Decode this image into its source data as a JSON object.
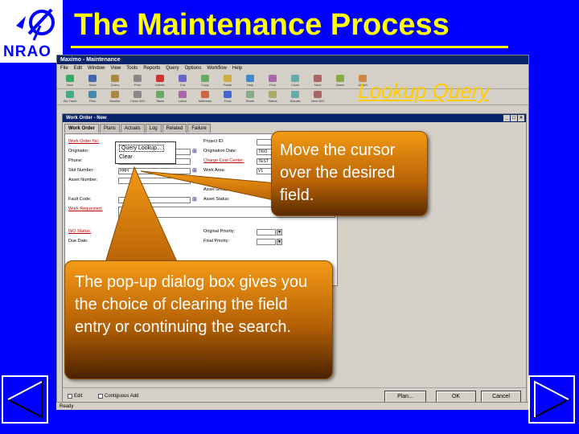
{
  "slide": {
    "title": "The Maintenance Process",
    "logo_text": "NRAO",
    "section_label": "Lookup Query"
  },
  "app": {
    "window_title": "Maximo - Maintenance",
    "menu": [
      "File",
      "Edit",
      "Window",
      "View",
      "Tools",
      "Reports",
      "Query",
      "Options",
      "Workflow",
      "Help"
    ],
    "toolbar_top": [
      "New",
      "Save",
      "Query",
      "Print",
      "Delete",
      "Cut",
      "Copy",
      "Paste",
      "Help",
      "Find",
      "Close",
      "Next",
      "Insert",
      "Attach"
    ],
    "toolbar_bottom": [
      "Wo Track",
      "Plan",
      "Monitor",
      "Close WO",
      "Tasks",
      "Labor",
      "Materials",
      "Tools",
      "Route",
      "Status",
      "Actuals",
      "Next WO"
    ],
    "inner_window_title": "Work Order - New",
    "tabs": [
      "Work Order",
      "Plans",
      "Actuals",
      "Log",
      "Related",
      "Failure"
    ],
    "fields_left": [
      {
        "label": "Work Order No:",
        "required": true
      },
      {
        "label": "Originator:",
        "required": false
      },
      {
        "label": "Phone:",
        "required": false
      },
      {
        "label": "Slot Number:",
        "required": false
      },
      {
        "label": "Asset Number:",
        "required": false
      },
      {
        "label": "Fault Code:",
        "required": false
      },
      {
        "label": "Work Requested:",
        "required": true
      },
      {
        "label": "WO Status:",
        "required": true
      },
      {
        "label": "Due Date:",
        "required": false
      }
    ],
    "fields_right": [
      {
        "label": "Project ID:",
        "required": false
      },
      {
        "label": "Origination Date:",
        "required": false
      },
      {
        "label": "Charge Cost Center:",
        "required": true
      },
      {
        "label": "Work Area:",
        "required": false
      },
      {
        "label": "Asset Group:",
        "required": false
      },
      {
        "label": "Asset Status:",
        "required": false
      },
      {
        "label": "Original Priority:",
        "required": false
      },
      {
        "label": "Final Priority:",
        "required": false
      }
    ],
    "field_values": {
      "slot": "HHH",
      "asset": "",
      "cost_center": "TEST",
      "origination": "7/6/0",
      "work_area": "V1",
      "priority": "",
      "final_priority": ""
    },
    "popup": {
      "item1": "Query Lookup...",
      "item2": "Clear"
    },
    "bottom": {
      "check1": "Edit",
      "check2": "Contiguous Add",
      "plan_button": "Plan...",
      "ok_button": "OK",
      "cancel_button": "Cancel"
    },
    "status_text": "Ready"
  },
  "callouts": {
    "cursor_text": "Move the cursor over the desired field.",
    "popup_text": "The pop-up dialog box gives you the choice of clearing the field entry or continuing the search."
  },
  "colors": {
    "background": "#0000ff",
    "title": "#ffff00",
    "lookup_label": "#ffcc00",
    "callout_top": "#f29a14",
    "callout_bottom": "#5a2c00"
  }
}
